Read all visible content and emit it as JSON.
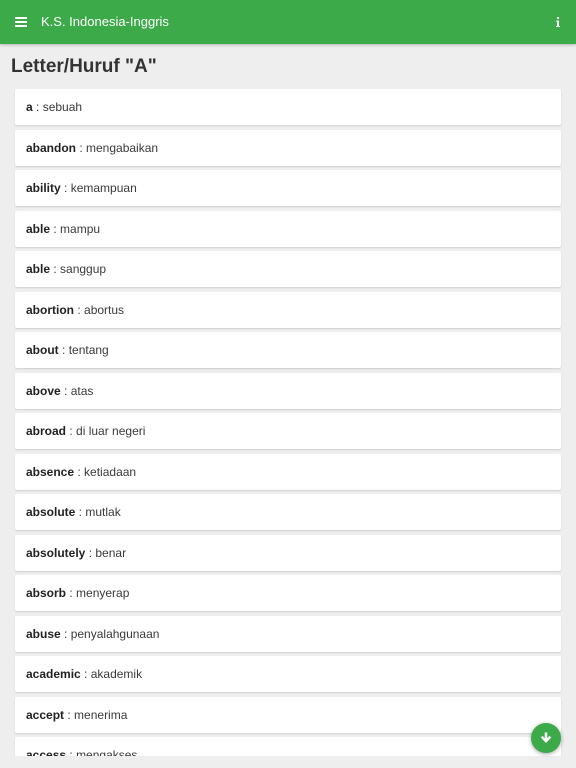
{
  "appbar": {
    "title": "K.S. Indonesia-Inggris",
    "menu_icon": "hamburger-menu-icon",
    "info_icon": "info-icon"
  },
  "page": {
    "heading": "Letter/Huruf \"A\""
  },
  "entries": [
    {
      "word": "a",
      "translation": "sebuah"
    },
    {
      "word": "abandon",
      "translation": "mengabaikan"
    },
    {
      "word": "ability",
      "translation": "kemampuan"
    },
    {
      "word": "able",
      "translation": "mampu"
    },
    {
      "word": "able",
      "translation": "sanggup"
    },
    {
      "word": "abortion",
      "translation": "abortus"
    },
    {
      "word": "about",
      "translation": "tentang"
    },
    {
      "word": "above",
      "translation": "atas"
    },
    {
      "word": "abroad",
      "translation": "di luar negeri"
    },
    {
      "word": "absence",
      "translation": "ketiadaan"
    },
    {
      "word": "absolute",
      "translation": "mutlak"
    },
    {
      "word": "absolutely",
      "translation": "benar"
    },
    {
      "word": "absorb",
      "translation": "menyerap"
    },
    {
      "word": "abuse",
      "translation": "penyalahgunaan"
    },
    {
      "word": "academic",
      "translation": "akademik"
    },
    {
      "word": "accept",
      "translation": "menerima"
    },
    {
      "word": "access",
      "translation": "mengakses"
    }
  ],
  "separator": " : ",
  "fab": {
    "icon": "arrow-down-icon"
  },
  "colors": {
    "primary": "#3daa4a",
    "background": "#eeeeee",
    "card": "#ffffff"
  }
}
